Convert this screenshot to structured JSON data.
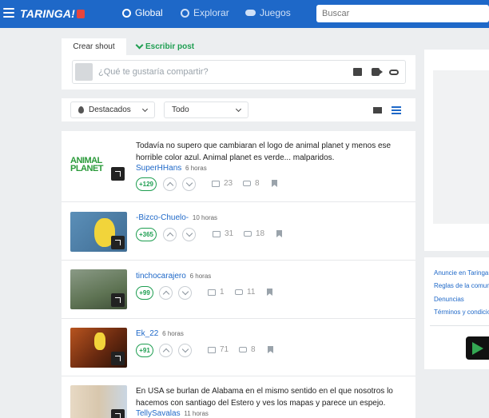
{
  "header": {
    "logo": "TARINGA!",
    "nav": [
      {
        "label": "Global",
        "icon": "globe-icon"
      },
      {
        "label": "Explorar",
        "icon": "compass-icon"
      },
      {
        "label": "Juegos",
        "icon": "gamepad-icon"
      }
    ],
    "search_placeholder": "Buscar"
  },
  "composer": {
    "tabs": [
      "Crear shout",
      "Escribir post"
    ],
    "placeholder": "¿Qué te gustaría compartir?",
    "tools": [
      "image-icon",
      "video-icon",
      "link-icon"
    ]
  },
  "filters": {
    "sort_value": "Destacados",
    "scope_value": "Todo",
    "view_modes": [
      "view-compact-icon",
      "view-list-icon"
    ]
  },
  "posts": [
    {
      "text": "Todavía no supero que cambiaran el logo de animal planet y menos ese horrible color azul. Animal planet es verde... malparidos.",
      "author": "SuperHHans",
      "ago": "6 horas",
      "score": "+129",
      "comments": "23",
      "reshares": "8",
      "thumb_text": "ANIMAL PLANET"
    },
    {
      "text": "",
      "author": "-Bizco-Chuelo-",
      "ago": "10 horas",
      "score": "+365",
      "comments": "31",
      "reshares": "18"
    },
    {
      "text": "",
      "author": "tinchocarajero",
      "ago": "6 horas",
      "score": "+99",
      "comments": "1",
      "reshares": "11"
    },
    {
      "text": "",
      "author": "Ek_22",
      "ago": "6 horas",
      "score": "+91",
      "comments": "71",
      "reshares": "8"
    },
    {
      "text": "En USA se burlan de Alabama en el mismo sentido en el que nosotros lo hacemos con santiago del Estero y ves los mapas y parece un espejo.",
      "author": "TellySavalas",
      "ago": "11 horas"
    }
  ],
  "sidebar": {
    "links": [
      "Anuncie en Taringa!",
      "Reglas de la comunidad",
      "Denuncias",
      "Términos y condiciones"
    ]
  },
  "colors": {
    "brand": "#1e68c8",
    "positive": "#1e9e51"
  }
}
